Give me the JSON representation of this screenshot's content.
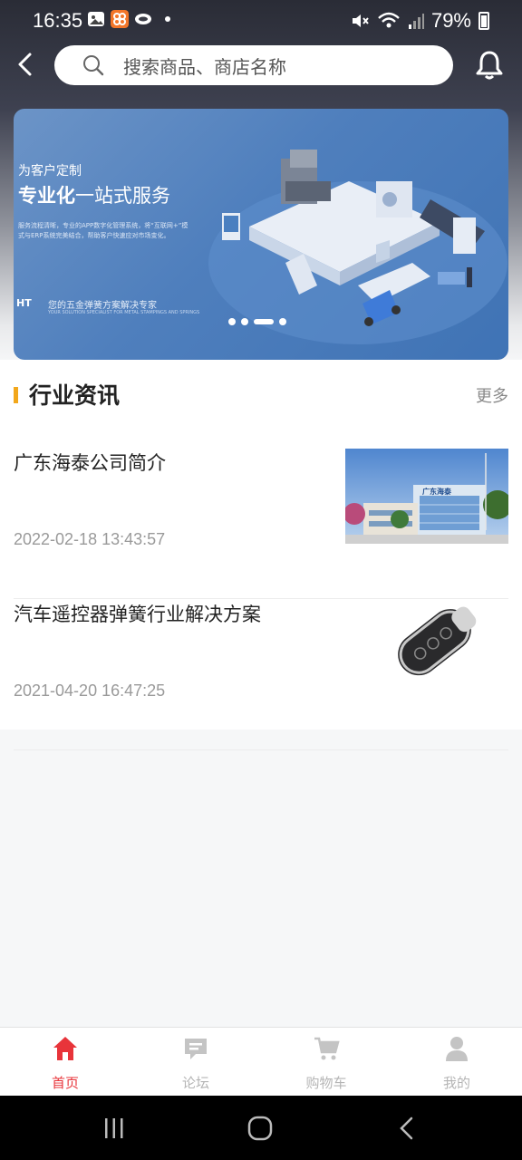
{
  "status": {
    "time": "16:35",
    "battery": "79%"
  },
  "search": {
    "placeholder": "搜索商品、商店名称"
  },
  "banner": {
    "tagline": "为客户定制",
    "headline_bold": "专业化",
    "headline_rest": "一站式服务",
    "body": "服务流程清晰，专业的APP数字化管理系统，将“互联网+”模式与ERP系统完美结合，帮助客户快速应对市场变化。",
    "logo": "HT",
    "slogan": "您的五金弹簧方案解决专家",
    "slogan_en": "YOUR SOLUTION SPECIALIST FOR METAL STAMPINGS AND SPRINGS",
    "sign_text": "广东海泰",
    "active_dot": 2,
    "dot_count": 4
  },
  "news": {
    "title": "行业资讯",
    "more": "更多",
    "items": [
      {
        "title": "广东海泰公司简介",
        "date": "2022-02-18 13:43:57",
        "thumb": "company-building"
      },
      {
        "title": "汽车遥控器弹簧行业解决方案",
        "date": "2021-04-20 16:47:25",
        "thumb": "car-key"
      }
    ]
  },
  "tabs": [
    {
      "label": "首页",
      "icon": "home-icon",
      "active": true
    },
    {
      "label": "论坛",
      "icon": "forum-icon",
      "active": false
    },
    {
      "label": "购物车",
      "icon": "cart-icon",
      "active": false
    },
    {
      "label": "我的",
      "icon": "user-icon",
      "active": false
    }
  ],
  "colors": {
    "accent": "#e8343a",
    "section_bar": "#f2a71b"
  }
}
